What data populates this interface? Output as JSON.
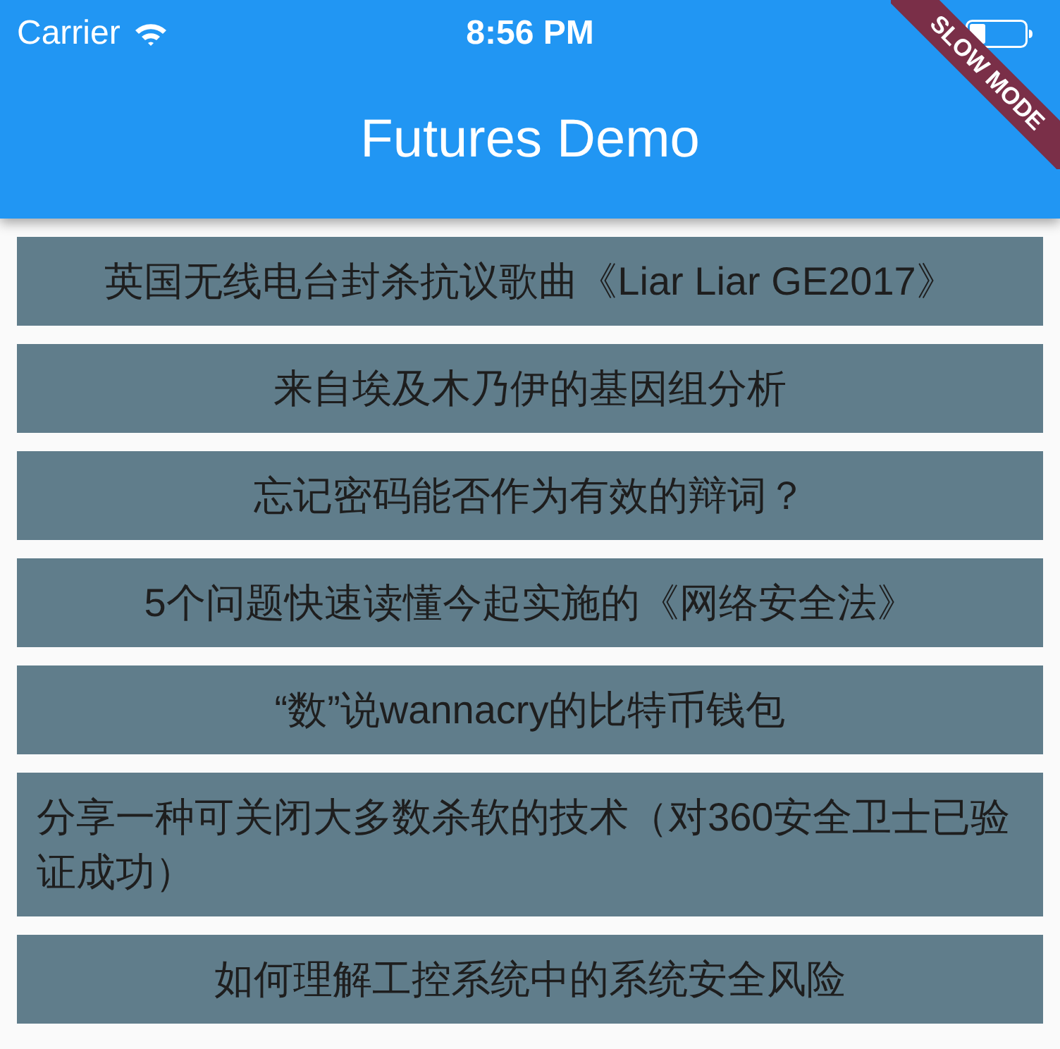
{
  "status_bar": {
    "carrier": "Carrier",
    "time": "8:56 PM"
  },
  "app_bar": {
    "title": "Futures Demo"
  },
  "debug_banner": {
    "label": "SLOW MODE"
  },
  "items": [
    {
      "title": "英国无线电台封杀抗议歌曲《Liar Liar GE2017》"
    },
    {
      "title": "来自埃及木乃伊的基因组分析"
    },
    {
      "title": "忘记密码能否作为有效的辩词？"
    },
    {
      "title": "5个问题快速读懂今起实施的《网络安全法》"
    },
    {
      "title": "“数”说wannacry的比特币钱包"
    },
    {
      "title": "分享一种可关闭大多数杀软的技术（对360安全卫士已验证成功）"
    },
    {
      "title": "如何理解工控系统中的系统安全风险"
    }
  ]
}
